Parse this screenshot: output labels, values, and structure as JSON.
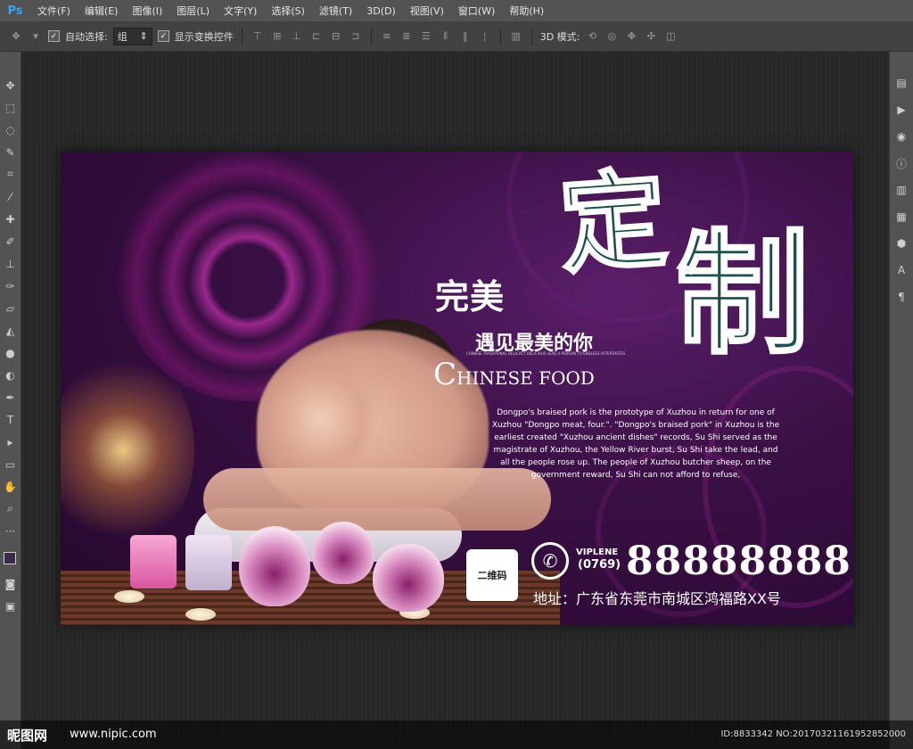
{
  "app": {
    "logo": "Ps"
  },
  "menu": [
    "文件(F)",
    "编辑(E)",
    "图像(I)",
    "图层(L)",
    "文字(Y)",
    "选择(S)",
    "滤镜(T)",
    "3D(D)",
    "视图(V)",
    "窗口(W)",
    "帮助(H)"
  ],
  "options": {
    "auto_select_label": "自动选择:",
    "auto_select_value": "组",
    "show_transform_label": "显示变换控件",
    "mode_3d_label": "3D 模式:"
  },
  "poster": {
    "title_small": "完美",
    "title_big_1": "定",
    "title_big_2": "制",
    "subtitle": "遇见最美的你",
    "tiny_text": "CHINESE TRADITIONAL DELICACY DELICIOUS LEAD A PERSON TO ENDLESS AFTERTASTES",
    "chinese_food_c": "C",
    "chinese_food_rest": "HINESE FOOD",
    "paragraph": "Dongpo's braised pork is the prototype of Xuzhou in return for one of Xuzhou \"Dongpo meat, four.\". \"Dongpo's braised pork\" in Xuzhou is the earliest created \"Xuzhou ancient dishes\" records, Su Shi served as the magistrate of Xuzhou, the Yellow River burst, Su Shi take the lead, and all the people rose up. The people of Xuzhou butcher sheep, on the government reward, Su Shi can not afford to refuse,",
    "qr_label": "二维码",
    "viplene": "VIPLENE",
    "area_code": "(0769)",
    "phone": "88888888",
    "address": "地址：广东省东莞市南城区鸿福路XX号"
  },
  "watermark": {
    "logo": "昵图网",
    "url": "www.nipic.com",
    "id": "ID:8833342 NO:20170321161952852000"
  }
}
